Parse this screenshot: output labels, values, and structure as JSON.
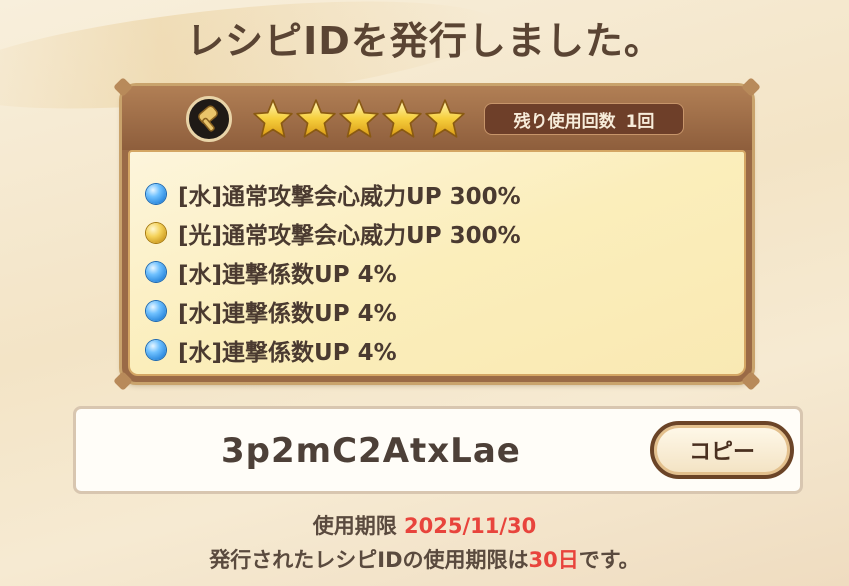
{
  "title": "レシピIDを発行しました。",
  "card": {
    "rarity_stars": 5,
    "remaining_label": "残り使用回数",
    "remaining_count": "1回",
    "effects": [
      {
        "element": "water",
        "text": "[水]通常攻撃会心威力UP 300%"
      },
      {
        "element": "light",
        "text": "[光]通常攻撃会心威力UP 300%"
      },
      {
        "element": "water",
        "text": "[水]連撃係数UP 4%"
      },
      {
        "element": "water",
        "text": "[水]連撃係数UP 4%"
      },
      {
        "element": "water",
        "text": "[水]連撃係数UP 4%"
      }
    ],
    "icon": "hammer-icon"
  },
  "recipe_id": "3p2mC2AtxLae",
  "copy_label": "コピー",
  "expiry": {
    "label": "使用期限",
    "date": "2025/11/30",
    "note_prefix": "発行されたレシピIDの使用期限は",
    "note_days": "30日",
    "note_suffix": "です。"
  },
  "colors": {
    "accent_red": "#e8443c",
    "card_brown": "#9a6a46",
    "text_dark": "#4a3a30"
  }
}
